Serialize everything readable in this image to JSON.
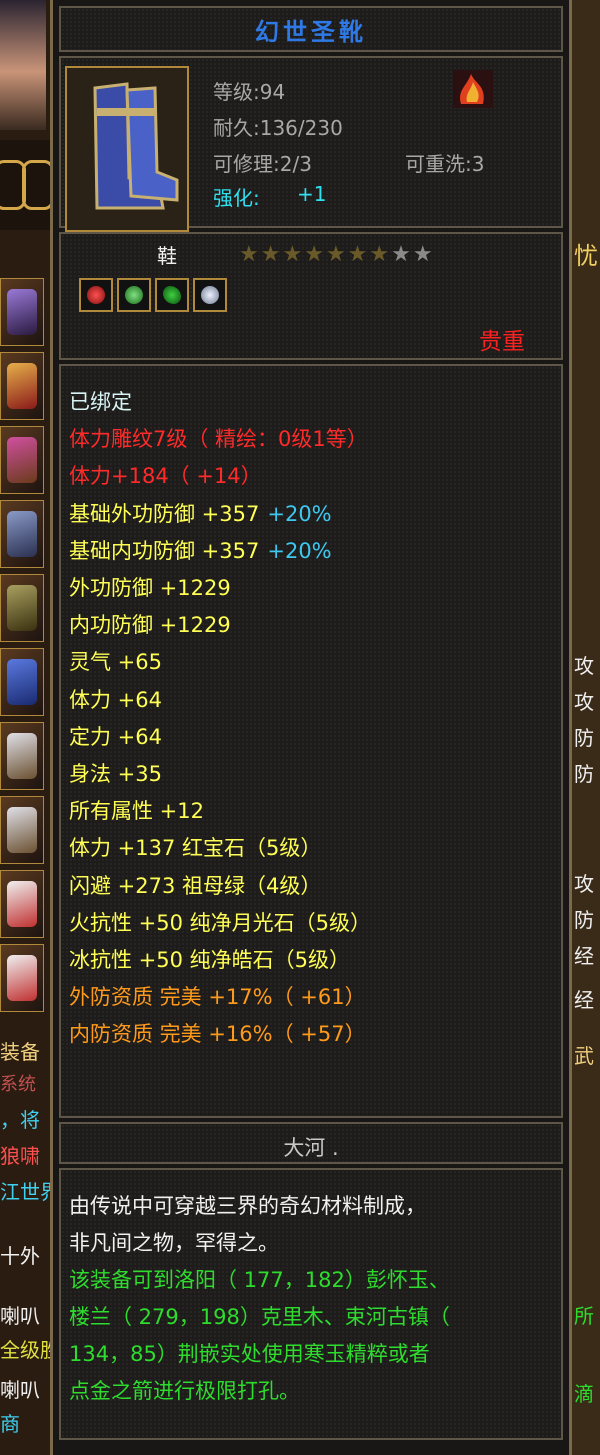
{
  "item": {
    "name": "幻世圣靴",
    "level": "等级:94",
    "durability": "耐久:136/230",
    "repair": "可修理:2/3",
    "rewash": "可重洗:3",
    "enhance_label": "强化:",
    "enhance_value": "+1",
    "type": "鞋",
    "stars_filled": 7,
    "stars_total": 9,
    "quality": "贵重",
    "source": "大河 ."
  },
  "attributes": [
    {
      "text": "已绑定",
      "color": "#d8f4f4"
    },
    {
      "text": "体力雕纹7级（ 精绘：0级1等）",
      "color": "#ff2a2a"
    },
    {
      "text": "体力+184（ +14）",
      "color": "#ff2a2a"
    },
    {
      "text": "基础外功防御 +357",
      "extra": "+20%",
      "color": "#ffff55",
      "extra_color": "#3ec8f0"
    },
    {
      "text": "基础内功防御 +357",
      "extra": "+20%",
      "color": "#ffff55",
      "extra_color": "#3ec8f0"
    },
    {
      "text": "外功防御 +1229",
      "color": "#ffff55"
    },
    {
      "text": "内功防御 +1229",
      "color": "#ffff55"
    },
    {
      "text": "灵气 +65",
      "color": "#ffff55"
    },
    {
      "text": "体力 +64",
      "color": "#ffff55"
    },
    {
      "text": "定力 +64",
      "color": "#ffff55"
    },
    {
      "text": "身法 +35",
      "color": "#ffff55"
    },
    {
      "text": "所有属性 +12",
      "color": "#ffff55"
    },
    {
      "text": "体力 +137 红宝石（5级）",
      "color": "#ffff55"
    },
    {
      "text": "闪避 +273 祖母绿（4级）",
      "color": "#ffff55"
    },
    {
      "text": "火抗性 +50 纯净月光石（5级）",
      "color": "#ffff55"
    },
    {
      "text": "冰抗性 +50 纯净皓石（5级）",
      "color": "#ffff55"
    },
    {
      "text": "外防资质  完美 +17%（ +61）",
      "color": "#ff9a1a"
    },
    {
      "text": "内防资质  完美 +16%（ +57）",
      "color": "#ff9a1a"
    }
  ],
  "description": [
    {
      "text": "由传说中可穿越三界的奇幻材料制成，",
      "color": "#f0f0f0"
    },
    {
      "text": "非凡间之物，罕得之。",
      "color": "#f0f0f0"
    },
    {
      "text": "该装备可到洛阳（ 177，182）彭怀玉、",
      "color": "#2edc2e"
    },
    {
      "text": "楼兰（ 279，198）克里木、束河古镇（",
      "color": "#2edc2e"
    },
    {
      "text": "134，85）荆嵌实处使用寒玉精粹或者",
      "color": "#2edc2e"
    },
    {
      "text": "点金之箭进行极限打孔。",
      "color": "#2edc2e"
    }
  ],
  "background": {
    "left_texts": [
      {
        "text": "装备",
        "color": "#f0d080"
      },
      {
        "text": "系统",
        "color": "#c05050"
      },
      {
        "text": "，将",
        "color": "#40d0f0"
      },
      {
        "text": "狼啸",
        "color": "#ff5050"
      },
      {
        "text": "江世界",
        "color": "#40d0f0"
      },
      {
        "text": "十外",
        "color": "#f0f0f0"
      },
      {
        "text": "喇叭",
        "color": "#f0f0f0"
      },
      {
        "text": "全级胜",
        "color": "#e0e040"
      },
      {
        "text": "喇叭",
        "color": "#f0f0f0"
      },
      {
        "text": "商",
        "color": "#40d0f0"
      }
    ],
    "right_texts": [
      {
        "text": "忧",
        "color": "#f0d060"
      },
      {
        "text": "攻",
        "color": "#f0f0f0"
      },
      {
        "text": "攻",
        "color": "#f0f0f0"
      },
      {
        "text": "防",
        "color": "#f0f0f0"
      },
      {
        "text": "防",
        "color": "#f0f0f0"
      },
      {
        "text": "攻",
        "color": "#f0f0f0"
      },
      {
        "text": "防",
        "color": "#f0f0f0"
      },
      {
        "text": "经",
        "color": "#f0f0f0"
      },
      {
        "text": "经",
        "color": "#f0f0f0"
      },
      {
        "text": "武",
        "color": "#f0d080"
      },
      {
        "text": "所",
        "color": "#2edc2e"
      },
      {
        "text": "滴",
        "color": "#2edc2e"
      }
    ]
  }
}
